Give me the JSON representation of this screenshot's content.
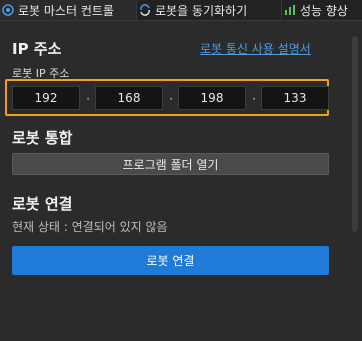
{
  "tabs": [
    {
      "label": "로봇 마스터 컨트롤",
      "icon": "robot-control-icon"
    },
    {
      "label": "로봇을 동기화하기",
      "icon": "robot-sync-icon"
    },
    {
      "label": "성능 향상",
      "icon": "bar-chart-icon"
    }
  ],
  "ip_section": {
    "title": "IP 주소",
    "help_link": "로봇 통신 사용 설명서",
    "label": "로봇 IP 주소",
    "octets": [
      "192",
      "168",
      "198",
      "133"
    ],
    "separator": "·"
  },
  "integration": {
    "title": "로봇 통합",
    "open_folder_button": "프로그램 폴더 열기"
  },
  "connection": {
    "title": "로봇 연결",
    "status": "현재 상태 : 연결되어 있지 않음",
    "connect_button": "로봇 연결"
  },
  "colors": {
    "accent": "#1f7ad8",
    "highlight": "#f0a020",
    "link": "#4a9be8",
    "background": "#2b2b2b"
  }
}
